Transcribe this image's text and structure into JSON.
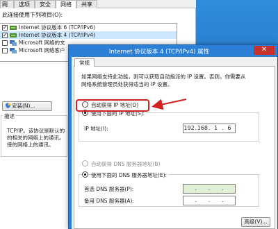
{
  "background_dialog": {
    "tabs": [
      "网络",
      "选项",
      "安全",
      "网络",
      "共享"
    ],
    "connection_label": "此连接使用下列项目(O):",
    "items": [
      {
        "label": "Internet 协议版本 6 (TCP/IPv6)",
        "checked": true,
        "selected": false
      },
      {
        "label": "Internet 协议版本 4 (TCP/IPv4)",
        "checked": true,
        "selected": true
      },
      {
        "label": "Microsoft 网络的文",
        "checked": false,
        "selected": false
      },
      {
        "label": "Microsoft 网络客户",
        "checked": false,
        "selected": false
      }
    ],
    "install_button": "安装(N)...",
    "description_title": "描述",
    "description_lines": [
      "TCP/IP。该协议是默认的",
      "的相关的网络上的通讯。",
      "接的网络上的通讯。"
    ]
  },
  "ipv4_dialog": {
    "title": "Internet 协议版本 4 (TCP/IPv4) 属性",
    "close_icon": "close-icon",
    "tab": "常规",
    "intro_line1": "如果网络支持此功能，则可以获取自动指派的 IP 设置。否则，你需要从",
    "intro_line2": "网络系统管理员处获得适当的 IP 设置。",
    "auto_ip": "自动获得 IP 地址(O)",
    "manual_ip": "使用下面的 IP 地址(S):",
    "ip_address_label": "IP 地址(I):",
    "ip_octets": [
      "192",
      "168",
      "1",
      "6"
    ],
    "auto_dns": "自动获得 DNS 服务器地址(B)",
    "manual_dns": "使用下面的 DNS 服务器地址(E):",
    "preferred_dns_label": "首选 DNS 服务器(P):",
    "alternate_dns_label": "备用 DNS 服务器(A):",
    "advanced_button": "高级(V)...",
    "selected_ip_mode": "manual",
    "selected_dns_mode": "manual"
  },
  "annotation": {
    "color": "#d4201c"
  },
  "colors": {
    "titlebar": "#2b7fd6",
    "close": "#c7312b",
    "selection": "#cde8ff"
  }
}
